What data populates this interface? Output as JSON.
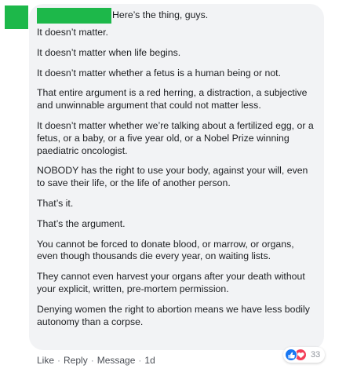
{
  "comment": {
    "greeting": "Here’s the thing, guys.",
    "paragraphs": [
      "It doesn’t matter.",
      "It doesn’t matter when life begins.",
      "It doesn’t matter whether a fetus is a human being or not.",
      "That entire argument is a red herring, a distraction, a subjective and unwinnable argument that could not matter less.",
      "It doesn’t matter whether we’re talking about a fertilized egg, or a fetus, or a baby, or a five year old, or a Nobel Prize winning paediatric oncologist.",
      "NOBODY has the right to use your body, against your will, even to save their life, or the life of another person.",
      "That’s it.",
      "That’s the argument.",
      "You cannot be forced to donate blood, or marrow, or organs, even though thousands die every year, on waiting lists.",
      "They cannot even harvest your organs after your death without your explicit, written, pre-mortem permission.",
      "Denying women the right to abortion means we have less bodily autonomy than a corpse."
    ]
  },
  "footer": {
    "like": "Like",
    "reply": "Reply",
    "message": "Message",
    "time": "1d",
    "separator": "·"
  },
  "reactions": {
    "count": "33",
    "icons": [
      "like-icon",
      "love-icon"
    ]
  },
  "colors": {
    "redaction": "#1db84a",
    "bubble": "#f2f3f5",
    "like": "#1877f2",
    "love": "#f33e58"
  }
}
